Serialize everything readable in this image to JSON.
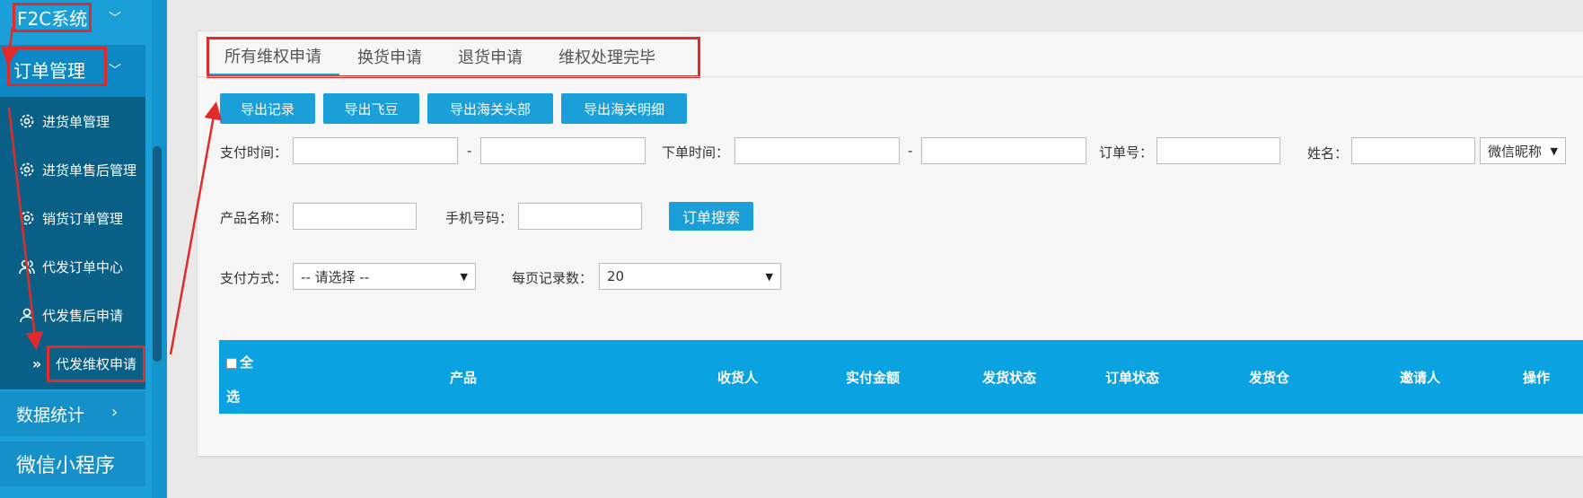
{
  "sidebar": {
    "system": "F2C系统",
    "order_mgmt": "订单管理",
    "items": [
      {
        "label": "进货单管理",
        "icon": "gear-icon"
      },
      {
        "label": "进货单售后管理",
        "icon": "gear-icon"
      },
      {
        "label": "销货订单管理",
        "icon": "gear-icon"
      },
      {
        "label": "代发订单中心",
        "icon": "users-icon"
      },
      {
        "label": "代发售后申请",
        "icon": "user-icon"
      },
      {
        "label": "代发维权申请",
        "icon": "double-chevron-icon"
      }
    ],
    "stats": "数据统计",
    "miniprogram": "微信小程序"
  },
  "tabs": [
    "所有维权申请",
    "换货申请",
    "退货申请",
    "维权处理完毕"
  ],
  "export_buttons": [
    "导出记录",
    "导出飞豆",
    "导出海关头部",
    "导出海关明细"
  ],
  "filters": {
    "pay_time": "支付时间：",
    "dash": "-",
    "order_time": "下单时间：",
    "order_no": "订单号：",
    "name": "姓名：",
    "name_type": "微信昵称",
    "product_name": "产品名称：",
    "phone": "手机号码：",
    "search": "订单搜索",
    "pay_method": "支付方式：",
    "pay_method_value": "-- 请选择 --",
    "page_size": "每页记录数：",
    "page_size_value": "20"
  },
  "table": {
    "select_all_1": "全",
    "select_all_2": "选",
    "columns": [
      "产品",
      "收货人",
      "实付金额",
      "发货状态",
      "订单状态",
      "发货仓",
      "邀请人",
      "操作"
    ]
  },
  "colors": {
    "accent": "#1a9fd9",
    "annotation": "#e12b2b",
    "sidebar_dark": "#0a5f86"
  }
}
